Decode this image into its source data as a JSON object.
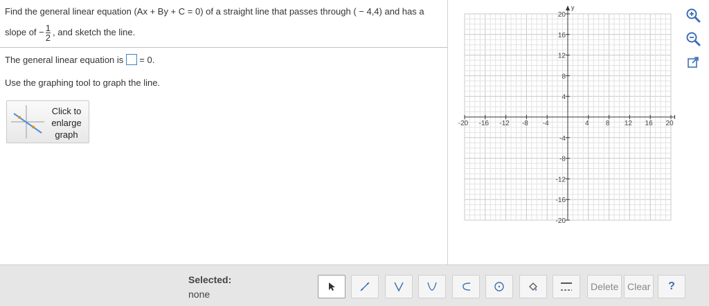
{
  "question": {
    "line1": "Find the general linear equation (Ax + By + C = 0) of a straight line that passes through ( − 4,4) and has a",
    "line2_prefix": "slope of  −",
    "slope_num": "1",
    "slope_den": "2",
    "line2_suffix": ", and sketch the line."
  },
  "answer": {
    "prefix": "The general linear equation is",
    "suffix": "= 0.",
    "value": ""
  },
  "instruction": "Use the graphing tool to graph the line.",
  "enlarge": {
    "label": "Click to enlarge graph"
  },
  "graph": {
    "x_label": "x",
    "y_label": "y",
    "range": [
      -20,
      20
    ],
    "grid_step": 1,
    "tick_step": 4,
    "x_ticks": [
      "-20",
      "-16",
      "-12",
      "-8",
      "-4",
      "4",
      "8",
      "12",
      "16",
      "20"
    ],
    "y_ticks": [
      "20",
      "16",
      "12",
      "8",
      "4",
      "-4",
      "-8",
      "-12",
      "-16",
      "-20"
    ]
  },
  "side_tools": [
    {
      "name": "zoom-in-icon"
    },
    {
      "name": "zoom-out-icon"
    },
    {
      "name": "popout-icon"
    }
  ],
  "bottom": {
    "selected_label": "Selected:",
    "selected_value": "none",
    "delete_label": "Delete",
    "clear_label": "Clear",
    "help_label": "?"
  },
  "colors": {
    "accent": "#3b82c4",
    "toolbar_bg": "#e6e6e6",
    "grid": "#dcdcdc",
    "tool_icon": "#3b6fb5"
  }
}
